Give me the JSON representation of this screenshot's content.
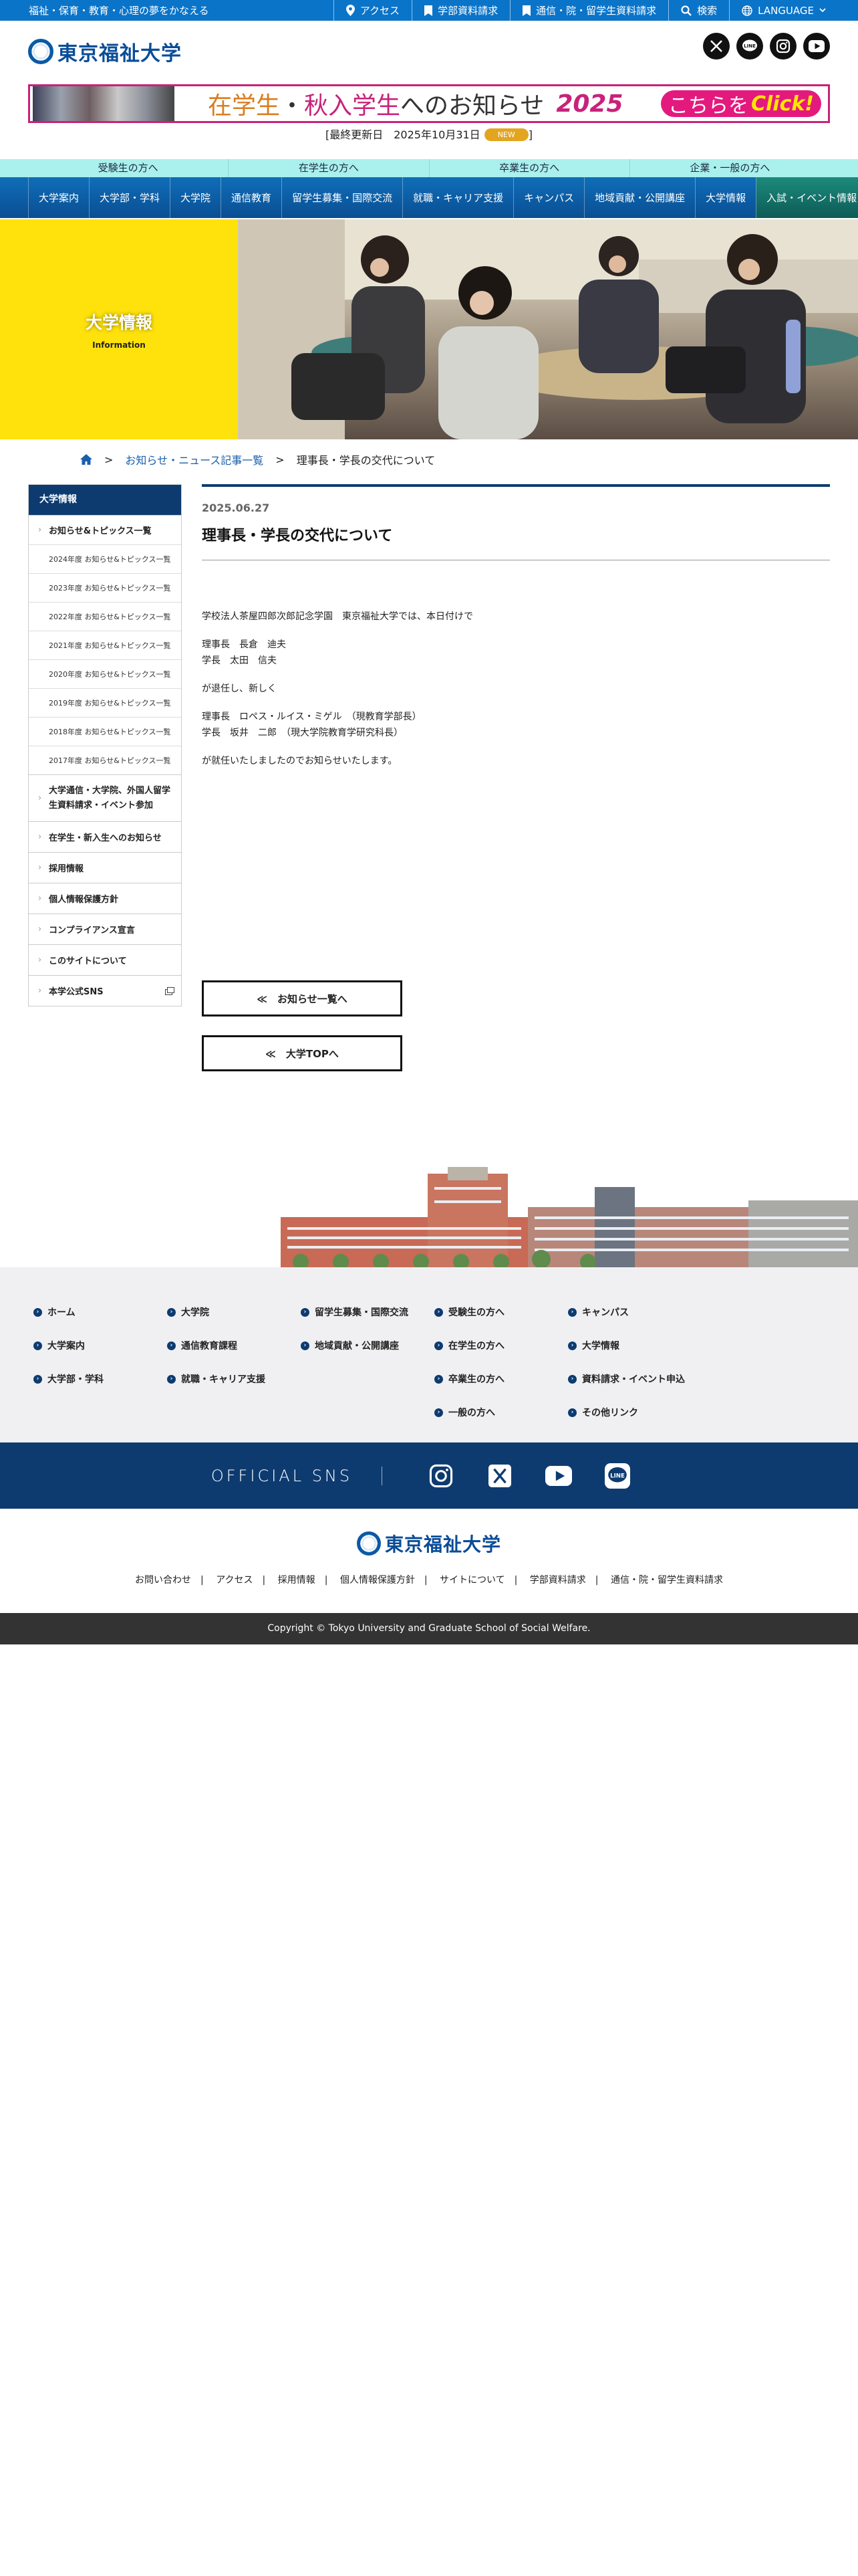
{
  "utility": {
    "tagline": "福祉・保育・教育・心理の夢をかなえる",
    "access": "アクセス",
    "undergrad_request": "学部資料請求",
    "online_request": "通信・院・留学生資料請求",
    "search": "検索",
    "language": "LANGUAGE"
  },
  "logo": {
    "name": "東京福祉大学"
  },
  "banner": {
    "part1": "在学生",
    "sep": "・",
    "part2": "秋入学生",
    "part3": "へのお知らせ",
    "year": "2025",
    "cta": "こちらを",
    "cta2": "Click!"
  },
  "updated": {
    "text": "[最終更新日　2025年10月31日",
    "badge": "NEW",
    "close": "]"
  },
  "audience": [
    "受験生の方へ",
    "在学生の方へ",
    "卒業生の方へ",
    "企業・一般の方へ"
  ],
  "nav": [
    "大学案内",
    "大学部・学科",
    "大学院",
    "通信教育",
    "留学生募集・国際交流",
    "就職・キャリア支援",
    "キャンパス",
    "地域貢献・公開講座",
    "大学情報",
    "入試・イベント情報"
  ],
  "hero": {
    "title": "大学情報",
    "subtitle": "Information"
  },
  "breadcrumb": {
    "level1": "お知らせ・ニュース記事一覧",
    "level2": "理事長・学長の交代について",
    "sep": ">"
  },
  "sidebar": {
    "heading": "大学情報",
    "topics": "お知らせ&トピックス一覧",
    "years": [
      "2024年度 お知らせ&トピックス一覧",
      "2023年度 お知らせ&トピックス一覧",
      "2022年度 お知らせ&トピックス一覧",
      "2021年度 お知らせ&トピックス一覧",
      "2020年度 お知らせ&トピックス一覧",
      "2019年度 お知らせ&トピックス一覧",
      "2018年度 お知らせ&トピックス一覧",
      "2017年度 お知らせ&トピックス一覧"
    ],
    "items": [
      "大学通信・大学院、外国人留学生資料請求・イベント参加",
      "在学生・新入生へのお知らせ",
      "採用情報",
      "個人情報保護方針",
      "コンプライアンス宣言",
      "このサイトについて",
      "本学公式SNS"
    ]
  },
  "article": {
    "date": "2025.06.27",
    "title": "理事長・学長の交代について",
    "p1": "学校法人茶屋四郎次郎記念学園　東京福祉大学では、本日付けで",
    "p2a": "理事長　長倉　迪夫",
    "p2b": "学長　太田　信夫",
    "p3": "が退任し、新しく",
    "p4a": "理事長　ロペス・ルイス・ミゲル　（現教育学部長）",
    "p4b": "学長　坂井　二郎　（現大学院教育学研究科長）",
    "p5": "が就任いたしましたのでお知らせいたします。",
    "btn_list": "≪　お知らせ一覧へ",
    "btn_top": "≪　大学TOPへ"
  },
  "footer_nav": [
    [
      "ホーム",
      "大学案内",
      "大学部・学科"
    ],
    [
      "大学院",
      "通信教育課程",
      "就職・キャリア支援"
    ],
    [
      "留学生募集・国際交流",
      "地域貢献・公開講座"
    ],
    [
      "受験生の方へ",
      "在学生の方へ",
      "卒業生の方へ",
      "一般の方へ"
    ],
    [
      "キャンパス",
      "大学情報",
      "資料請求・イベント申込",
      "その他リンク"
    ]
  ],
  "sns_label": "OFFICIAL SNS",
  "footer_links": [
    "お問い合わせ",
    "アクセス",
    "採用情報",
    "個人情報保護方針",
    "サイトについて",
    "学部資料請求",
    "通信・院・留学生資料請求"
  ],
  "copyright": "Copyright © Tokyo University and Graduate School of Social Welfare."
}
